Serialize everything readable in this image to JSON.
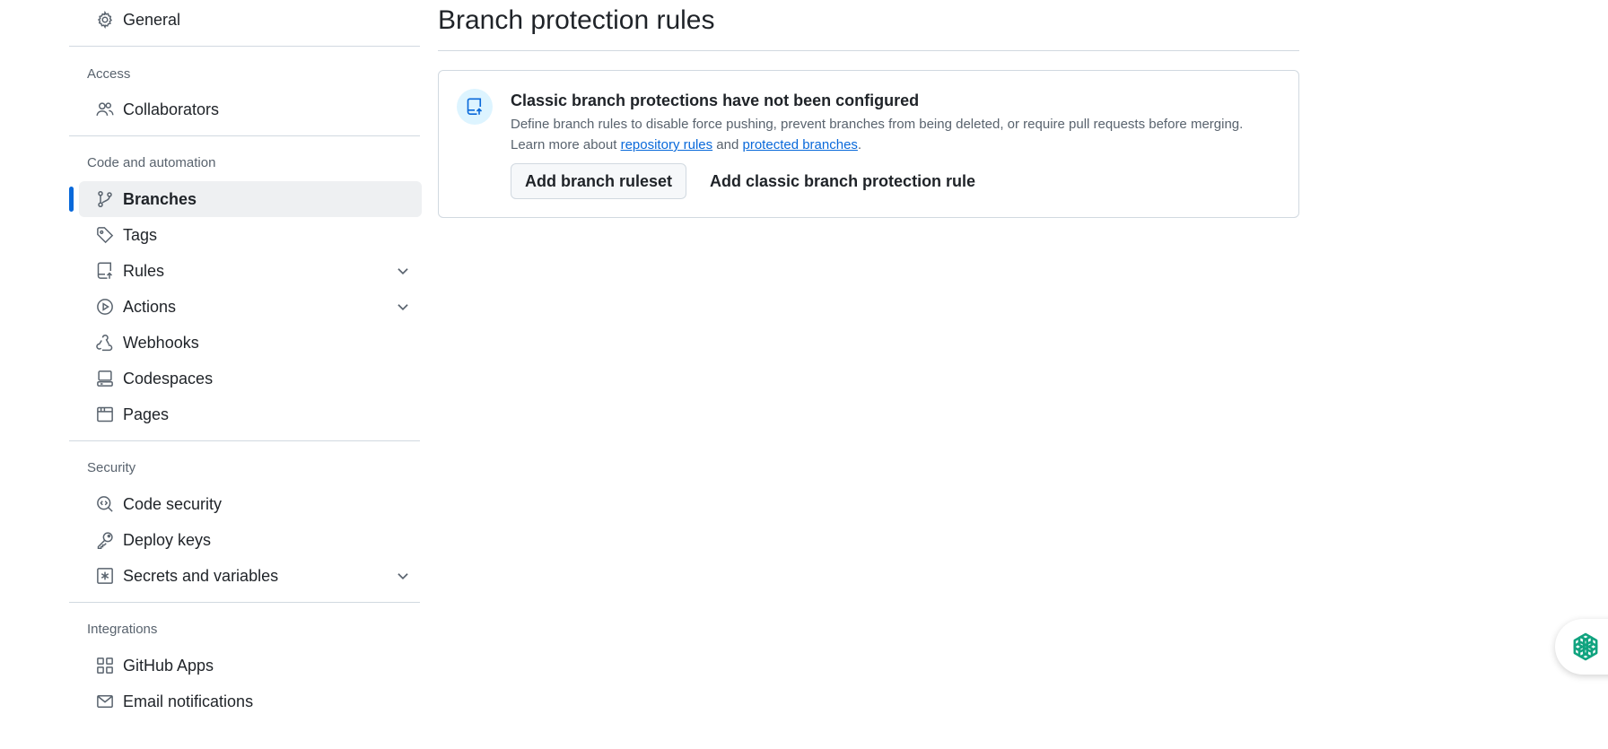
{
  "sidebar": {
    "general": "General",
    "sections": {
      "access": "Access",
      "code_automation": "Code and automation",
      "security": "Security",
      "integrations": "Integrations"
    },
    "items": {
      "collaborators": "Collaborators",
      "branches": "Branches",
      "tags": "Tags",
      "rules": "Rules",
      "actions": "Actions",
      "webhooks": "Webhooks",
      "codespaces": "Codespaces",
      "pages": "Pages",
      "code_security": "Code security",
      "deploy_keys": "Deploy keys",
      "secrets": "Secrets and variables",
      "github_apps": "GitHub Apps",
      "email_notifications": "Email notifications"
    },
    "active_item": "Branches"
  },
  "main": {
    "title": "Branch protection rules",
    "card": {
      "title": "Classic branch protections have not been configured",
      "desc_line1": "Define branch rules to disable force pushing, prevent branches from being deleted, or require pull requests before merging.",
      "desc_prefix": "Learn more about ",
      "link1": "repository rules",
      "desc_and": " and ",
      "link2": "protected branches",
      "desc_suffix": ".",
      "button_ruleset": "Add branch ruleset",
      "button_classic": "Add classic branch protection rule"
    }
  },
  "colors": {
    "accent": "#0969da",
    "assistant": "#10a37f"
  },
  "icons": {
    "general": "gear-icon",
    "collaborators": "people-icon",
    "branches": "git-branch-icon",
    "tags": "tag-icon",
    "rules": "repo-push-icon",
    "actions": "play-icon",
    "webhooks": "webhook-icon",
    "codespaces": "codespaces-icon",
    "pages": "browser-icon",
    "code_security": "codescan-icon",
    "deploy_keys": "key-icon",
    "secrets": "key-asterisk-icon",
    "github_apps": "apps-icon",
    "email_notifications": "mail-icon",
    "assistant": "openai-logo-icon"
  }
}
